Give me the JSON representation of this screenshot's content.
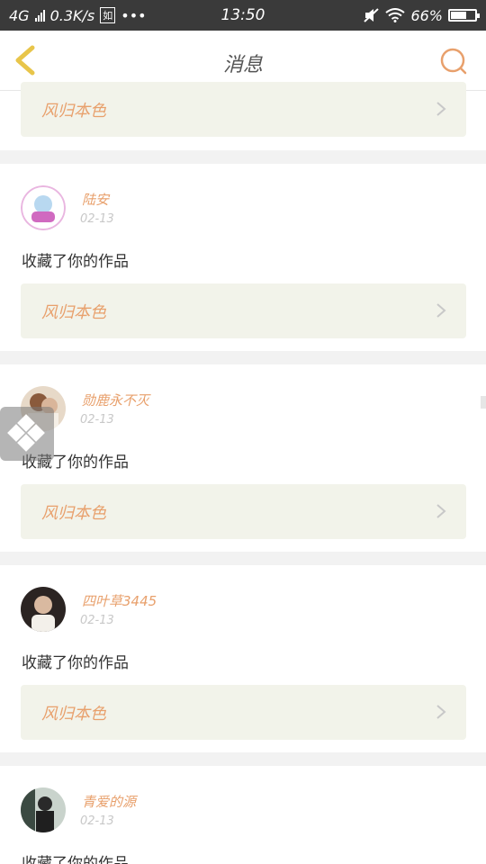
{
  "status_bar": {
    "network": "4G",
    "speed": "0.3K/s",
    "badge": "如",
    "more": "•••",
    "time": "13:50",
    "battery_text": "66%",
    "battery_level": 0.66
  },
  "header": {
    "title": "消息"
  },
  "work_title": "风归本色",
  "items": [
    {
      "name": "陆安",
      "date": "02-13",
      "action": "收藏了你的作品"
    },
    {
      "name": "勋鹿永不灭",
      "date": "02-13",
      "action": "收藏了你的作品"
    },
    {
      "name": "四叶草3445",
      "date": "02-13",
      "action": "收藏了你的作品"
    },
    {
      "name": "青爱的源",
      "date": "02-13",
      "action": "收藏了你的作品"
    }
  ],
  "colors": {
    "accent": "#e8a06c",
    "back_icon": "#e8c54a",
    "card_bg": "#f2f3ea",
    "status_bar": "#3a3a3a"
  }
}
